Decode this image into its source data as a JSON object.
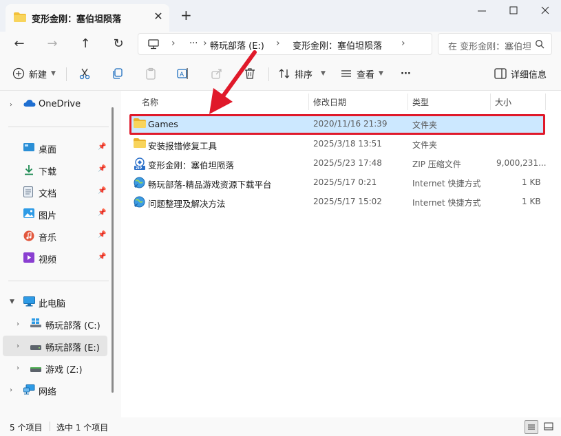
{
  "window": {
    "tab_title": "变形金刚：塞伯坦陨落",
    "tab_close": "✕",
    "new_tab": "+"
  },
  "address": {
    "ellipsis": "···",
    "crumbs": [
      "畅玩部落 (E:)",
      "变形金刚：塞伯坦陨落"
    ],
    "search_placeholder": "在 变形金刚：塞伯坦陨落 中搜索"
  },
  "toolbar": {
    "new_label": "新建",
    "sort_label": "排序",
    "view_label": "查看",
    "more_label": "···",
    "details_label": "详细信息"
  },
  "sidebar": {
    "onedrive": "OneDrive",
    "quick": [
      {
        "label": "桌面",
        "icon": "desktop-icon"
      },
      {
        "label": "下载",
        "icon": "download-icon"
      },
      {
        "label": "文档",
        "icon": "document-icon"
      },
      {
        "label": "图片",
        "icon": "picture-icon"
      },
      {
        "label": "音乐",
        "icon": "music-icon"
      },
      {
        "label": "视频",
        "icon": "video-icon"
      }
    ],
    "this_pc": "此电脑",
    "drives": [
      "畅玩部落 (C:)",
      "畅玩部落 (E:)",
      "游戏 (Z:)"
    ],
    "network": "网络"
  },
  "columns": {
    "name": "名称",
    "date": "修改日期",
    "type": "类型",
    "size": "大小"
  },
  "files": [
    {
      "name": "Games",
      "date": "2020/11/16 21:39",
      "type": "文件夹",
      "size": ""
    },
    {
      "name": "安装报错修复工具",
      "date": "2025/3/18 13:51",
      "type": "文件夹",
      "size": ""
    },
    {
      "name": "变形金刚：塞伯坦陨落",
      "date": "2025/5/23 17:48",
      "type": "ZIP 压缩文件",
      "size": "9,000,231..."
    },
    {
      "name": "畅玩部落-精品游戏资源下载平台",
      "date": "2025/5/17 0:21",
      "type": "Internet 快捷方式",
      "size": "1 KB"
    },
    {
      "name": "问题整理及解决方法",
      "date": "2025/5/17 15:02",
      "type": "Internet 快捷方式",
      "size": "1 KB"
    }
  ],
  "status": {
    "count": "5 个项目",
    "selected": "选中 1 个项目"
  },
  "colors": {
    "highlight_fill": "#cce8ff",
    "annotation_red": "#e0192a",
    "folder_yellow": "#f3c13a"
  }
}
